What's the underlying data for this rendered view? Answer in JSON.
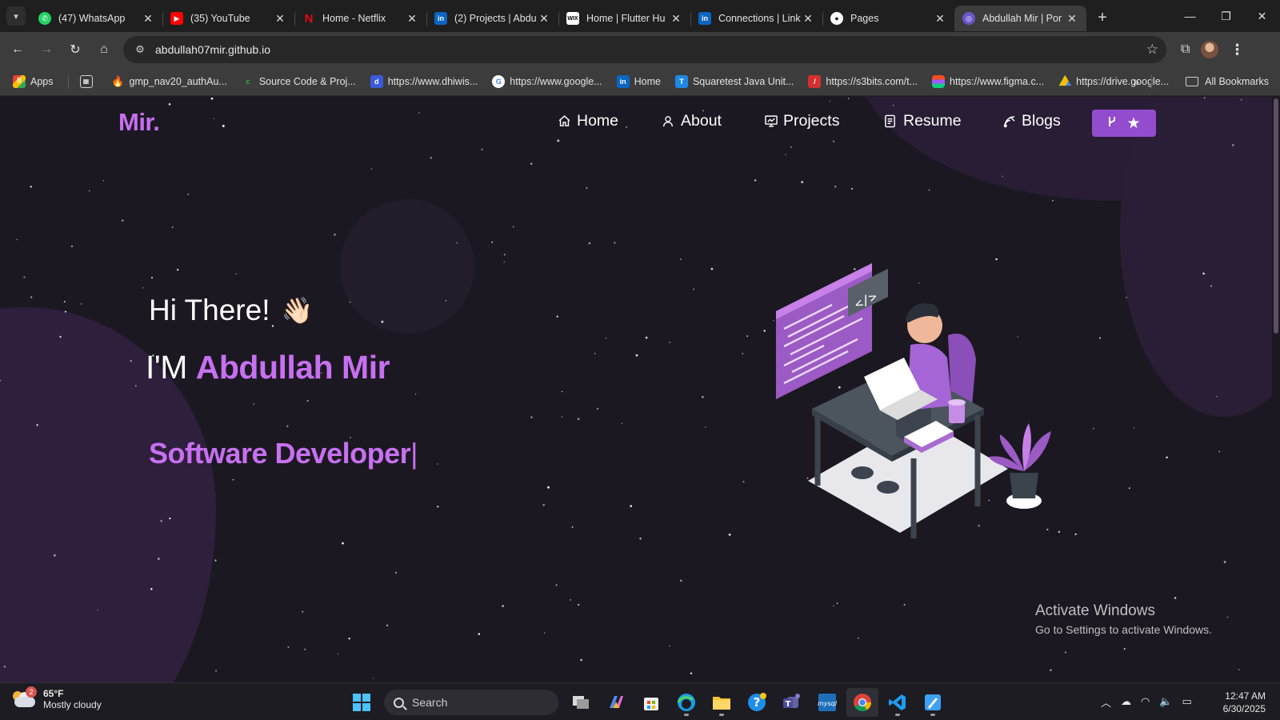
{
  "browser": {
    "tabs": [
      {
        "title": "(47) WhatsApp",
        "icon": "whatsapp-icon",
        "color": "#25d366",
        "active": false
      },
      {
        "title": "(35) YouTube",
        "icon": "youtube-icon",
        "color": "#ff0000",
        "active": false
      },
      {
        "title": "Home - Netflix",
        "icon": "netflix-icon",
        "color": "#e50914",
        "active": false
      },
      {
        "title": "(2) Projects | Abdu",
        "icon": "linkedin-icon",
        "color": "#0a66c2",
        "active": false
      },
      {
        "title": "Home | Flutter Hu",
        "icon": "wix-icon",
        "color": "#ffffff",
        "active": false
      },
      {
        "title": "Connections | Link",
        "icon": "linkedin-icon",
        "color": "#0a66c2",
        "active": false
      },
      {
        "title": "Pages",
        "icon": "github-icon",
        "color": "#ffffff",
        "active": false
      },
      {
        "title": "Abdullah Mir | Por",
        "icon": "portfolio-icon",
        "color": "#9b7bff",
        "active": true
      }
    ],
    "url": "abdullah07mir.github.io",
    "bookmarks": [
      {
        "label": "Apps",
        "icon": "apps-grid-icon",
        "color": "#ea4335"
      },
      {
        "label": "gmp_nav20_authAu...",
        "icon": "firebase-icon",
        "color": "#ffa000"
      },
      {
        "label": "Source Code & Proj...",
        "icon": "codeastro-icon",
        "color": "#3fae49"
      },
      {
        "label": "https://www.dhiwis...",
        "icon": "dhiwise-icon",
        "color": "#3b5bdb"
      },
      {
        "label": "https://www.google...",
        "icon": "google-icon",
        "color": "#4285f4"
      },
      {
        "label": "Home",
        "icon": "linkedin-icon",
        "color": "#0a66c2"
      },
      {
        "label": "Squaretest Java Unit...",
        "icon": "squaretest-icon",
        "color": "#1e88e5"
      },
      {
        "label": "https://s3bits.com/t...",
        "icon": "s3bits-icon",
        "color": "#d32f2f"
      },
      {
        "label": "https://www.figma.c...",
        "icon": "figma-icon",
        "color": "#f24e1e"
      },
      {
        "label": "https://drive.google...",
        "icon": "google-drive-icon",
        "color": "#0f9d58"
      }
    ],
    "all_bookmarks_label": "All Bookmarks"
  },
  "site": {
    "logo": "Mir.",
    "nav": [
      {
        "label": "Home",
        "icon": "home-icon"
      },
      {
        "label": "About",
        "icon": "user-icon"
      },
      {
        "label": "Projects",
        "icon": "projects-icon"
      },
      {
        "label": "Resume",
        "icon": "document-icon"
      },
      {
        "label": "Blogs",
        "icon": "blog-icon"
      }
    ],
    "fork_button": {
      "icon1": "git-fork-icon",
      "icon2": "star-icon"
    },
    "accent_color": "#c770f0",
    "button_color": "#934cce",
    "background_color": "#1c1822",
    "hero": {
      "greeting": "Hi There!",
      "wave": "👋🏻",
      "intro_prefix": "I'M",
      "name": "Abdullah Mir",
      "typed_text": "Software Developer",
      "cursor": "|"
    },
    "illustration": "developer-at-desk-illustration"
  },
  "windows": {
    "activate_title": "Activate Windows",
    "activate_subtitle": "Go to Settings to activate Windows."
  },
  "taskbar": {
    "weather": {
      "temp": "65°F",
      "condition": "Mostly cloudy",
      "badge": "2"
    },
    "search_placeholder": "Search",
    "apps": [
      "task-view-icon",
      "copilot-icon",
      "microsoft-store-icon",
      "edge-icon",
      "file-explorer-icon",
      "get-help-icon",
      "teams-icon",
      "mysql-workbench-icon",
      "chrome-icon",
      "vscode-icon",
      "paint-icon"
    ],
    "time": "12:47 AM",
    "date": "6/30/2025"
  }
}
